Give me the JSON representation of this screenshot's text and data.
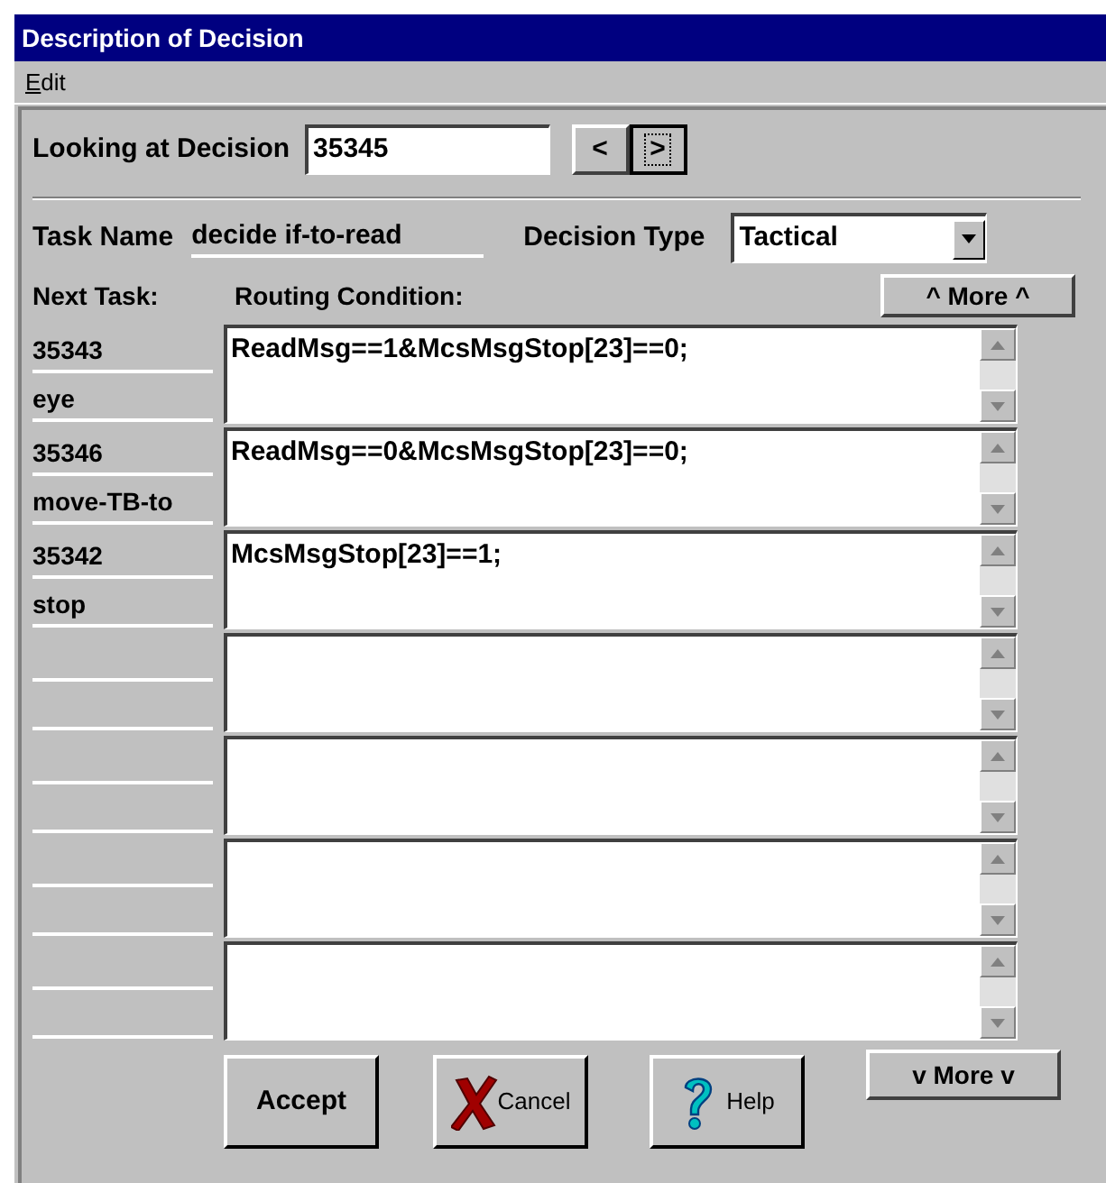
{
  "window": {
    "title": "Description of Decision"
  },
  "menu": [
    "Edit"
  ],
  "decision": {
    "label": "Looking at Decision",
    "value": "35345",
    "prev": "<",
    "next": ">"
  },
  "task": {
    "label": "Task Name",
    "value": "decide if-to-read",
    "type_label": "Decision Type",
    "type_value": "Tactical"
  },
  "headers": {
    "next_task": "Next Task:",
    "routing": "Routing Condition:",
    "more_up": "^ More ^"
  },
  "rows": [
    {
      "task_id": "35343",
      "task_name": "eye",
      "condition": "ReadMsg==1&McsMsgStop[23]==0;"
    },
    {
      "task_id": "35346",
      "task_name": "move-TB-to",
      "condition": "ReadMsg==0&McsMsgStop[23]==0;"
    },
    {
      "task_id": "35342",
      "task_name": "stop",
      "condition": "McsMsgStop[23]==1;"
    },
    {},
    {},
    {},
    {}
  ],
  "buttons": {
    "accept": "Accept",
    "cancel": "Cancel",
    "help": "Help",
    "more_down": "v More v"
  }
}
